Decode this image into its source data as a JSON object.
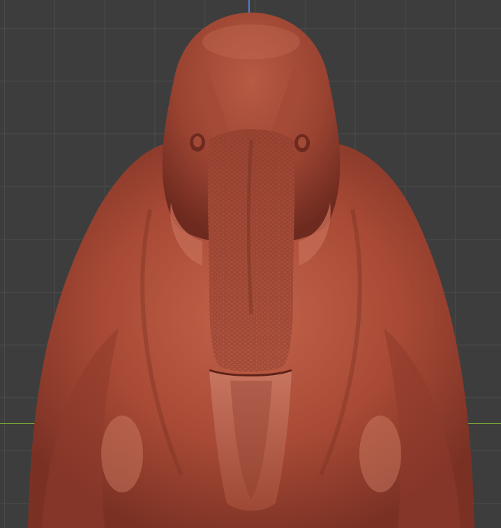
{
  "viewport": {
    "background": "#3d3d3d",
    "grid_color": "#4b4b4b",
    "axis_colors": {
      "vertical": "#4a7fd6",
      "horizontal": "#7ba33a"
    }
  },
  "model": {
    "icon": "dinosaur-sculpt",
    "material_color": "#b5533f",
    "shadow_color": "#6e2a1f",
    "highlight_color": "#d9826a"
  }
}
